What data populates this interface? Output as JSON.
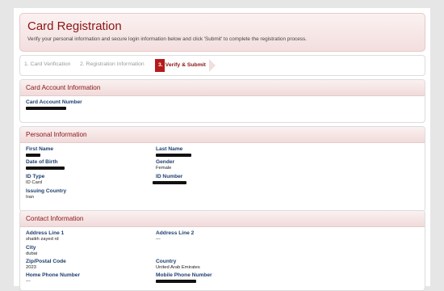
{
  "header": {
    "title": "Card Registration",
    "subtitle": "Verify your personal information and secure login information below and click 'Submit' to complete the registration process."
  },
  "steps": [
    {
      "label": "1. Card Verification",
      "state": "done"
    },
    {
      "label": "2. Registration Information",
      "state": "done"
    },
    {
      "num": "3.",
      "label": "Verify & Submit",
      "state": "active"
    }
  ],
  "card_account": {
    "heading": "Card Account Information",
    "account_number_label": "Card Account Number"
  },
  "personal": {
    "heading": "Personal Information",
    "first_name_label": "First Name",
    "last_name_label": "Last Name",
    "dob_label": "Date of Birth",
    "gender_label": "Gender",
    "gender_value": "Female",
    "id_type_label": "ID Type",
    "id_type_value": "ID Card",
    "id_number_label": "ID Number",
    "issuing_country_label": "Issuing Country",
    "issuing_country_value": "Iran"
  },
  "contact": {
    "heading": "Contact Information",
    "address1_label": "Address Line 1",
    "address1_value": "shaikh zayed rd",
    "address2_label": "Address Line 2",
    "address2_value": "---",
    "city_label": "City",
    "city_value": "dubai",
    "country_label": "Country",
    "country_value": "United Arab Emirates",
    "zip_label": "Zip/Postal Code",
    "zip_value": "2023",
    "home_phone_label": "Home Phone Number",
    "home_phone_value": "---",
    "mobile_phone_label": "Mobile Phone Number"
  },
  "colors": {
    "brand": "#8b1414",
    "label": "#1e3f6f",
    "step_active": "#b51b1b"
  }
}
